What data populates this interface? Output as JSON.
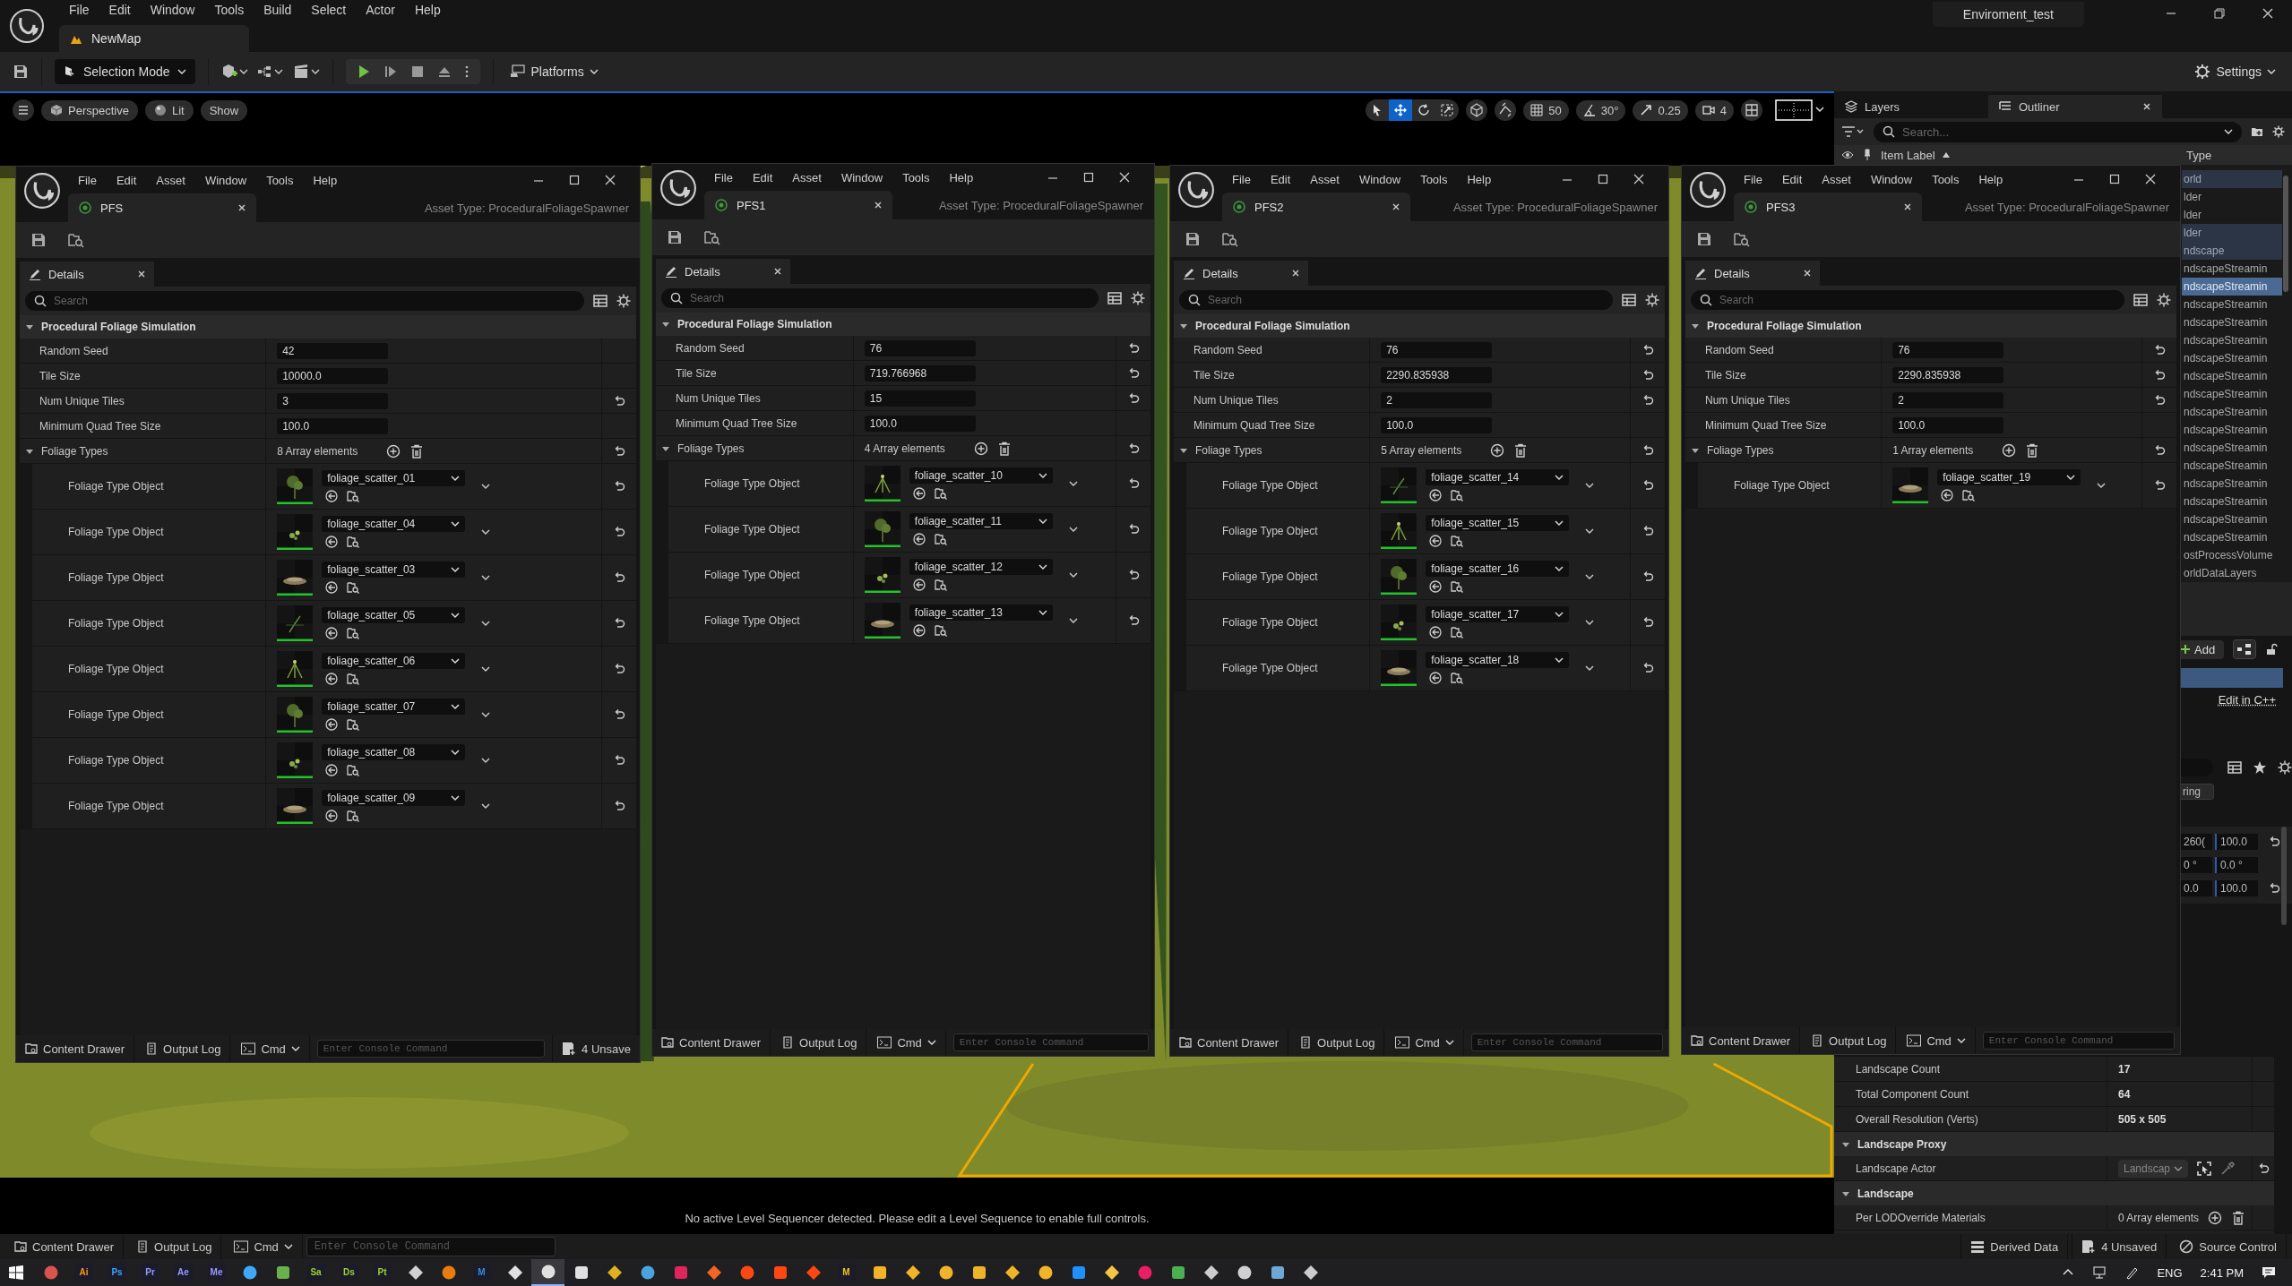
{
  "app": {
    "menu": [
      "File",
      "Edit",
      "Window",
      "Tools",
      "Build",
      "Select",
      "Actor",
      "Help"
    ],
    "level_tab": "NewMap",
    "project": "Enviroment_test"
  },
  "toolbar": {
    "mode": "Selection Mode",
    "platforms": "Platforms",
    "settings": "Settings"
  },
  "viewport": {
    "view_buttons": [
      "Perspective",
      "Lit",
      "Show"
    ],
    "transform_tools": [
      {
        "kind": "select",
        "selected": false
      },
      {
        "kind": "move",
        "selected": true
      },
      {
        "kind": "rotate",
        "selected": false
      },
      {
        "kind": "scale",
        "selected": false
      }
    ],
    "snaps": [
      {
        "kind": "grid",
        "label": "50"
      },
      {
        "kind": "angle",
        "label": "30°"
      },
      {
        "kind": "scale",
        "label": "0.25"
      },
      {
        "kind": "camera",
        "label": "4"
      }
    ],
    "message": "No active Level Sequencer detected. Please edit a Level Sequence to enable full controls."
  },
  "asset_windows": [
    {
      "menu": [
        "File",
        "Edit",
        "Asset",
        "Window",
        "Tools",
        "Help"
      ],
      "tab": "PFS",
      "asset_type": "Asset Type: ProceduralFoliageSpawner",
      "details_tab": "Details",
      "search_placeholder": "Search",
      "section": "Procedural Foliage Simulation",
      "properties": [
        {
          "label": "Random Seed",
          "value": "42",
          "modified": false
        },
        {
          "label": "Tile Size",
          "value": "10000.0",
          "modified": false
        },
        {
          "label": "Num Unique Tiles",
          "value": "3",
          "modified": true
        },
        {
          "label": "Minimum Quad Tree Size",
          "value": "100.0",
          "modified": false
        }
      ],
      "foliage": {
        "label": "Foliage Types",
        "count": "8 Array elements",
        "modified": true,
        "items": [
          {
            "label": "Foliage Type Object",
            "asset": "foliage_scatter_01",
            "modified": true
          },
          {
            "label": "Foliage Type Object",
            "asset": "foliage_scatter_04",
            "modified": true
          },
          {
            "label": "Foliage Type Object",
            "asset": "foliage_scatter_03",
            "modified": true
          },
          {
            "label": "Foliage Type Object",
            "asset": "foliage_scatter_05",
            "modified": true
          },
          {
            "label": "Foliage Type Object",
            "asset": "foliage_scatter_06",
            "modified": true
          },
          {
            "label": "Foliage Type Object",
            "asset": "foliage_scatter_07",
            "modified": true
          },
          {
            "label": "Foliage Type Object",
            "asset": "foliage_scatter_08",
            "modified": true
          },
          {
            "label": "Foliage Type Object",
            "asset": "foliage_scatter_09",
            "modified": true
          }
        ]
      },
      "bottom": {
        "content_drawer": "Content Drawer",
        "output_log": "Output Log",
        "cmd": "Cmd",
        "console_placeholder": "Enter Console Command",
        "unsaved": "4 Unsave"
      }
    },
    {
      "menu": [
        "File",
        "Edit",
        "Asset",
        "Window",
        "Tools",
        "Help"
      ],
      "tab": "PFS1",
      "asset_type": "Asset Type: ProceduralFoliageSpawner",
      "details_tab": "Details",
      "search_placeholder": "Search",
      "section": "Procedural Foliage Simulation",
      "properties": [
        {
          "label": "Random Seed",
          "value": "76",
          "modified": true
        },
        {
          "label": "Tile Size",
          "value": "719.766968",
          "modified": true
        },
        {
          "label": "Num Unique Tiles",
          "value": "15",
          "modified": true
        },
        {
          "label": "Minimum Quad Tree Size",
          "value": "100.0",
          "modified": false
        }
      ],
      "foliage": {
        "label": "Foliage Types",
        "count": "4 Array elements",
        "modified": true,
        "items": [
          {
            "label": "Foliage Type Object",
            "asset": "foliage_scatter_10",
            "modified": true
          },
          {
            "label": "Foliage Type Object",
            "asset": "foliage_scatter_11",
            "modified": true
          },
          {
            "label": "Foliage Type Object",
            "asset": "foliage_scatter_12",
            "modified": true
          },
          {
            "label": "Foliage Type Object",
            "asset": "foliage_scatter_13",
            "modified": true
          }
        ]
      },
      "bottom": {
        "content_drawer": "Content Drawer",
        "output_log": "Output Log",
        "cmd": "Cmd",
        "console_placeholder": "Enter Console Command"
      }
    },
    {
      "menu": [
        "File",
        "Edit",
        "Asset",
        "Window",
        "Tools",
        "Help"
      ],
      "tab": "PFS2",
      "asset_type": "Asset Type: ProceduralFoliageSpawner",
      "details_tab": "Details",
      "search_placeholder": "Search",
      "section": "Procedural Foliage Simulation",
      "properties": [
        {
          "label": "Random Seed",
          "value": "76",
          "modified": true
        },
        {
          "label": "Tile Size",
          "value": "2290.835938",
          "modified": true
        },
        {
          "label": "Num Unique Tiles",
          "value": "2",
          "modified": true
        },
        {
          "label": "Minimum Quad Tree Size",
          "value": "100.0",
          "modified": false
        }
      ],
      "foliage": {
        "label": "Foliage Types",
        "count": "5 Array elements",
        "modified": true,
        "items": [
          {
            "label": "Foliage Type Object",
            "asset": "foliage_scatter_14",
            "modified": true
          },
          {
            "label": "Foliage Type Object",
            "asset": "foliage_scatter_15",
            "modified": true
          },
          {
            "label": "Foliage Type Object",
            "asset": "foliage_scatter_16",
            "modified": true
          },
          {
            "label": "Foliage Type Object",
            "asset": "foliage_scatter_17",
            "modified": true
          },
          {
            "label": "Foliage Type Object",
            "asset": "foliage_scatter_18",
            "modified": true
          }
        ]
      },
      "bottom": {
        "content_drawer": "Content Drawer",
        "output_log": "Output Log",
        "cmd": "Cmd",
        "console_placeholder": "Enter Console Command"
      }
    },
    {
      "menu": [
        "File",
        "Edit",
        "Asset",
        "Window",
        "Tools",
        "Help"
      ],
      "tab": "PFS3",
      "asset_type": "Asset Type: ProceduralFoliageSpawner",
      "details_tab": "Details",
      "search_placeholder": "Search",
      "section": "Procedural Foliage Simulation",
      "properties": [
        {
          "label": "Random Seed",
          "value": "76",
          "modified": true
        },
        {
          "label": "Tile Size",
          "value": "2290.835938",
          "modified": true
        },
        {
          "label": "Num Unique Tiles",
          "value": "2",
          "modified": true
        },
        {
          "label": "Minimum Quad Tree Size",
          "value": "100.0",
          "modified": false
        }
      ],
      "foliage": {
        "label": "Foliage Types",
        "count": "1 Array elements",
        "modified": true,
        "items": [
          {
            "label": "Foliage Type Object",
            "asset": "foliage_scatter_19",
            "modified": true
          }
        ]
      },
      "bottom": {
        "content_drawer": "Content Drawer",
        "output_log": "Output Log",
        "cmd": "Cmd",
        "console_placeholder": "Enter Console Command"
      }
    }
  ],
  "outliner": {
    "layers_tab": "Layers",
    "outliner_tab": "Outliner",
    "search_placeholder": "Search...",
    "columns": [
      "Item Label",
      "Type"
    ],
    "rows": [
      {
        "text": "orld",
        "selected": false,
        "highlighted": true
      },
      {
        "text": "lder",
        "selected": false,
        "highlighted": false
      },
      {
        "text": "lder",
        "selected": false,
        "highlighted": false
      },
      {
        "text": "lder",
        "selected": false,
        "highlighted": true
      },
      {
        "text": "ndscape",
        "selected": false,
        "highlighted": true
      },
      {
        "text": "ndscapeStreamin",
        "selected": false,
        "highlighted": false
      },
      {
        "text": "ndscapeStreamin",
        "selected": true,
        "highlighted": false
      },
      {
        "text": "ndscapeStreamin",
        "selected": false,
        "highlighted": false
      },
      {
        "text": "ndscapeStreamin",
        "selected": false,
        "highlighted": false
      },
      {
        "text": "ndscapeStreamin",
        "selected": false,
        "highlighted": false
      },
      {
        "text": "ndscapeStreamin",
        "selected": false,
        "highlighted": false
      },
      {
        "text": "ndscapeStreamin",
        "selected": false,
        "highlighted": false
      },
      {
        "text": "ndscapeStreamin",
        "selected": false,
        "highlighted": false
      },
      {
        "text": "ndscapeStreamin",
        "selected": false,
        "highlighted": false
      },
      {
        "text": "ndscapeStreamin",
        "selected": false,
        "highlighted": false
      },
      {
        "text": "ndscapeStreamin",
        "selected": false,
        "highlighted": false
      },
      {
        "text": "ndscapeStreamin",
        "selected": false,
        "highlighted": false
      },
      {
        "text": "ndscapeStreamin",
        "selected": false,
        "highlighted": false
      },
      {
        "text": "ndscapeStreamin",
        "selected": false,
        "highlighted": false
      },
      {
        "text": "ndscapeStreamin",
        "selected": false,
        "highlighted": false
      },
      {
        "text": "ndscapeStreamin",
        "selected": false,
        "highlighted": false
      },
      {
        "text": "ostProcessVolume",
        "selected": false,
        "highlighted": false
      },
      {
        "text": "orldDataLayers",
        "selected": false,
        "highlighted": false
      }
    ]
  },
  "details": {
    "add": "Add",
    "edit_link": "Edit in C++",
    "chip": "ring",
    "transform": [
      {
        "values": [
          "260(",
          "100.0"
        ],
        "modified": true
      },
      {
        "values": [
          "0 °",
          "0.0 °"
        ],
        "modified": false
      },
      {
        "values": [
          "0.0",
          "100.0"
        ],
        "modified": true
      }
    ],
    "landscape": [
      {
        "kind": "row",
        "label": "Landscape Count",
        "value": "17",
        "modified": false
      },
      {
        "kind": "row",
        "label": "Total Component Count",
        "value": "64",
        "modified": false
      },
      {
        "kind": "row",
        "label": "Overall Resolution (Verts)",
        "value": "505 x 505",
        "modified": false
      },
      {
        "kind": "section",
        "label": "Landscape Proxy"
      },
      {
        "kind": "actor",
        "label": "Landscape Actor",
        "value": "Landscap",
        "modified": true
      },
      {
        "kind": "section",
        "label": "Landscape"
      },
      {
        "kind": "array",
        "label": "Per LODOverride Materials",
        "value": "0 Array elements",
        "modified": false
      }
    ]
  },
  "status_bar": {
    "content_drawer": "Content Drawer",
    "output_log": "Output Log",
    "cmd": "Cmd",
    "console_placeholder": "Enter Console Command",
    "derived_data": "Derived Data",
    "unsaved": "4 Unsaved",
    "source_control": "Source Control"
  },
  "taskbar": {
    "apps": [
      {
        "color": "#d9534f",
        "active": false
      },
      {
        "label": "Ai",
        "color": "#ff9a00",
        "active": false
      },
      {
        "label": "Ps",
        "color": "#31a8ff",
        "active": false
      },
      {
        "label": "Pr",
        "color": "#9999ff",
        "active": false
      },
      {
        "label": "Ae",
        "color": "#9999ff",
        "active": false
      },
      {
        "label": "Me",
        "color": "#9999ff",
        "active": false
      },
      {
        "color": "#3fa9f5",
        "active": false
      },
      {
        "color": "#6ab04c",
        "active": false
      },
      {
        "label": "Sa",
        "color": "#9ad32f",
        "active": false
      },
      {
        "label": "Ds",
        "color": "#9ad32f",
        "active": false
      },
      {
        "label": "Pt",
        "color": "#9ad32f",
        "active": false
      },
      {
        "color": "#d0d0d0",
        "active": false
      },
      {
        "color": "#e87d0d",
        "active": false
      },
      {
        "label": "M",
        "color": "#2f8fd8",
        "active": false
      },
      {
        "color": "#e0e0e0",
        "active": false
      },
      {
        "color": "#e0e0e0",
        "active": true
      },
      {
        "color": "#e0e0e0",
        "active": false
      },
      {
        "color": "#e0b020",
        "active": false
      },
      {
        "color": "#4aa3df",
        "active": false
      },
      {
        "color": "#e0245e",
        "active": false
      },
      {
        "color": "#f26522",
        "active": false
      },
      {
        "color": "#ff4713",
        "active": false
      },
      {
        "color": "#ff4713",
        "active": false
      },
      {
        "color": "#ff4713",
        "active": false
      },
      {
        "label": "M",
        "color": "#f5c518",
        "active": false
      },
      {
        "color": "#f0b429",
        "active": false
      },
      {
        "color": "#f0b429",
        "active": false
      },
      {
        "color": "#f0b429",
        "active": false
      },
      {
        "color": "#f0b429",
        "active": false
      },
      {
        "color": "#f0b429",
        "active": false
      },
      {
        "color": "#f0b429",
        "active": false
      },
      {
        "color": "#1e90ff",
        "active": false
      },
      {
        "color": "#f4c542",
        "active": false
      },
      {
        "color": "#e91e63",
        "active": false
      },
      {
        "color": "#4caf50",
        "active": false
      },
      {
        "color": "#cccccc",
        "active": false
      },
      {
        "color": "#d0d0d0",
        "active": false
      },
      {
        "color": "#6ea8d8",
        "active": false
      },
      {
        "color": "#cccccc",
        "active": false
      }
    ],
    "language": "ENG",
    "time": "2:41 PM"
  }
}
